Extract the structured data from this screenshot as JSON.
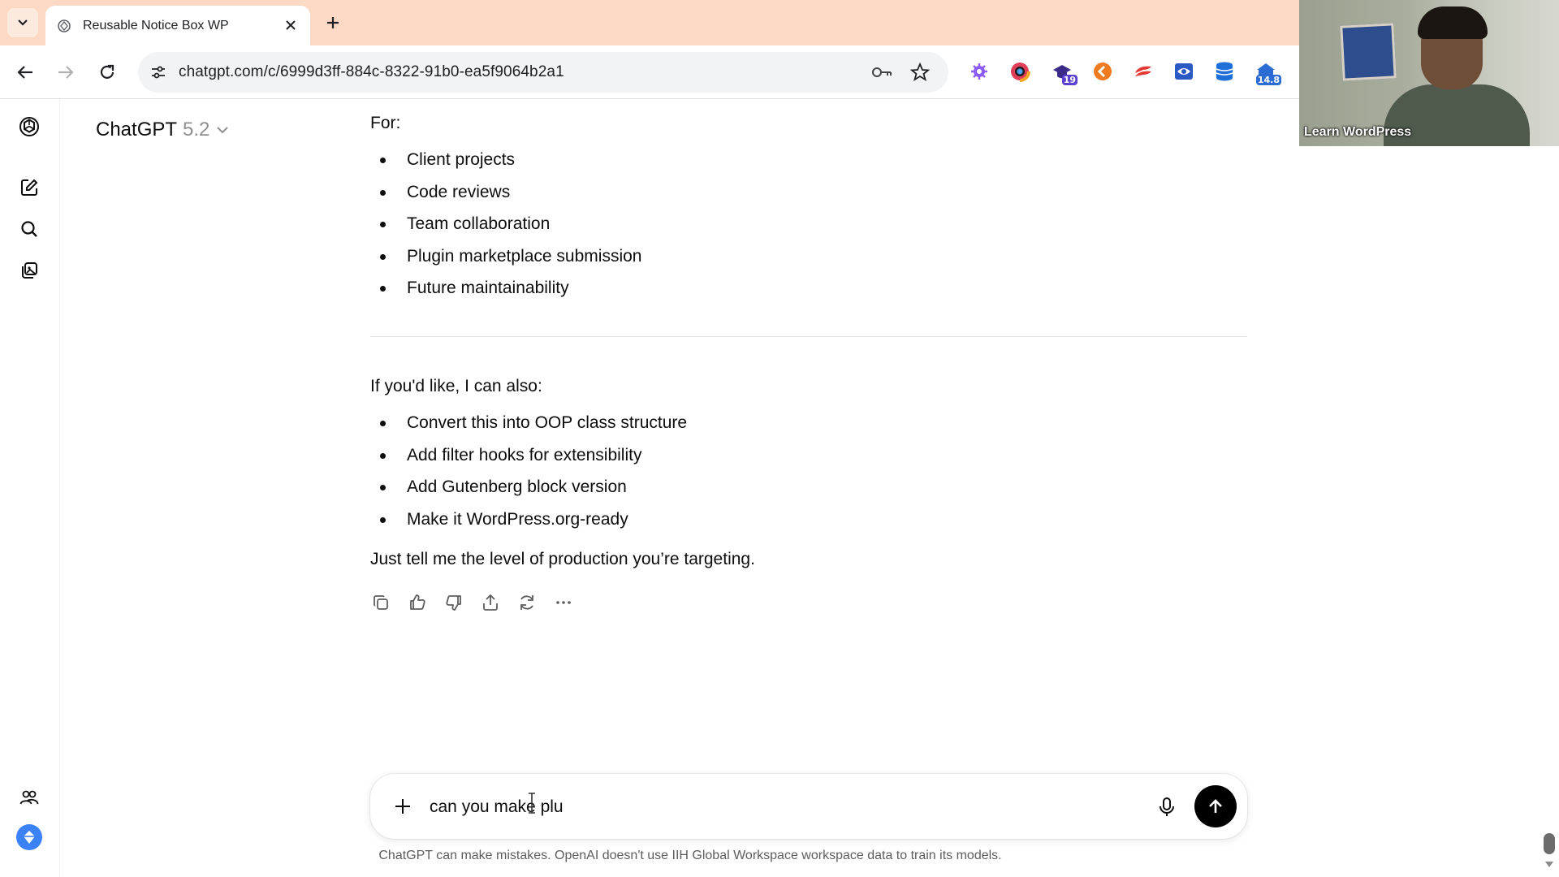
{
  "browser": {
    "tab_title": "Reusable Notice Box WP",
    "url": "chatgpt.com/c/6999d3ff-884c-8322-91b0-ea5f9064b2a1",
    "extension_badges": {
      "notifications": "19",
      "coins": "14.8"
    },
    "colors": {
      "tabbar": "#fbd9c4",
      "omnibox": "#f1f3f4"
    }
  },
  "webcam": {
    "label": "Learn WordPress"
  },
  "header": {
    "model_name": "ChatGPT",
    "model_version": "5.2"
  },
  "message": {
    "intro_for": "For:",
    "for_items": [
      "Client projects",
      "Code reviews",
      "Team collaboration",
      "Plugin marketplace submission",
      "Future maintainability"
    ],
    "offer": "If you'd like, I can also:",
    "offer_items": [
      "Convert this into OOP class structure",
      "Add filter hooks for extensibility",
      "Add Gutenberg block version",
      "Make it WordPress.org-ready"
    ],
    "closing": "Just tell me the level of production you’re targeting."
  },
  "message_actions": [
    "copy-icon",
    "thumbs-up-icon",
    "thumbs-down-icon",
    "share-icon",
    "regenerate-icon",
    "more-icon"
  ],
  "composer": {
    "value": "can you make plu"
  },
  "footer": {
    "disclaimer": "ChatGPT can make mistakes. OpenAI doesn't use IIH Global Workspace workspace data to train its models."
  }
}
